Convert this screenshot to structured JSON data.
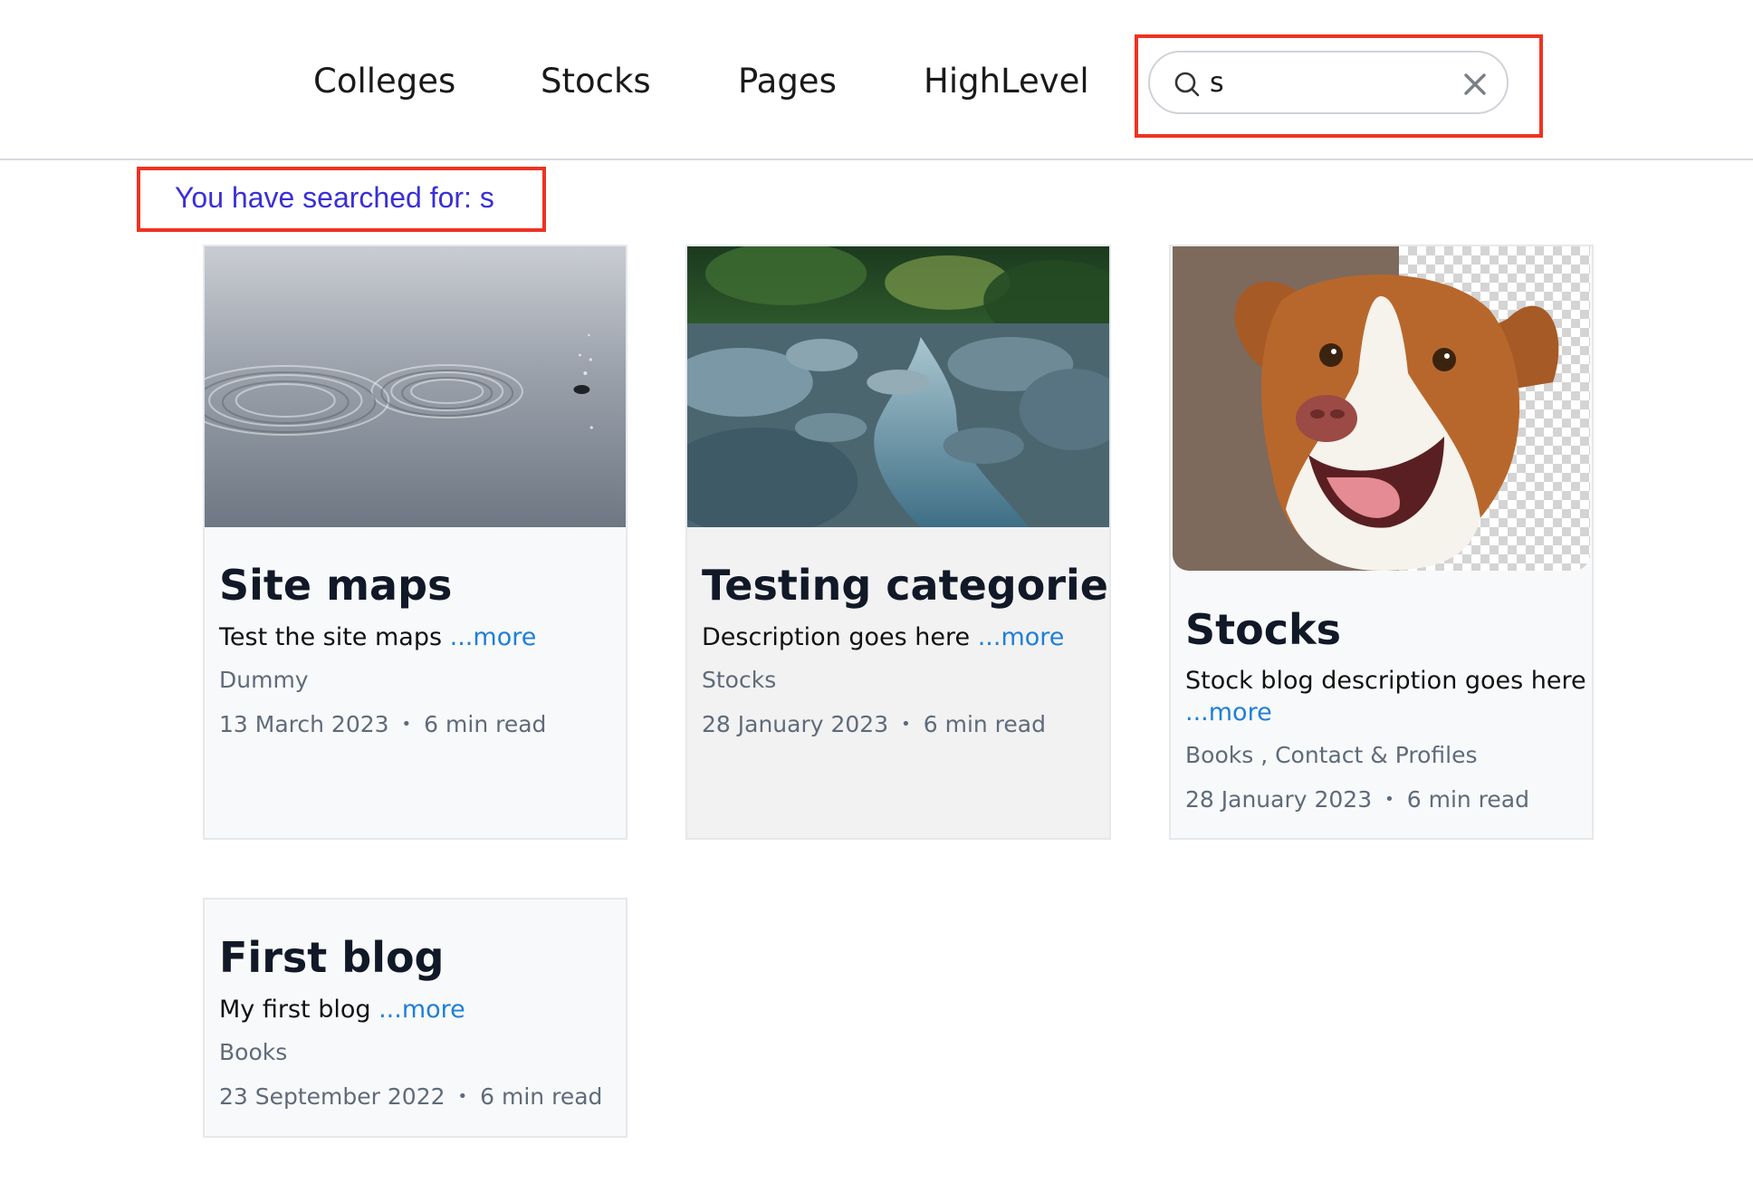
{
  "nav": {
    "items": [
      {
        "label": "Colleges"
      },
      {
        "label": "Stocks"
      },
      {
        "label": "Pages"
      },
      {
        "label": "HighLevel"
      }
    ]
  },
  "search": {
    "value": "s",
    "icon": "search-icon",
    "clear_icon": "close-icon"
  },
  "summary": {
    "text": "You have searched for: s"
  },
  "colors": {
    "highlight": "#ee3322",
    "summary_text": "#3a2fd6",
    "more_link": "#1e7fd8"
  },
  "cards": [
    {
      "title": "Site maps",
      "description": "Test the site maps",
      "more": "...more",
      "category": "Dummy",
      "date": "13 March 2023",
      "separator": "•",
      "read_time": "6 min read"
    },
    {
      "title": "Testing categories",
      "description": "Description goes here",
      "more": "...more",
      "category": "Stocks",
      "date": "28 January 2023",
      "separator": "•",
      "read_time": "6 min read"
    },
    {
      "title": "Stocks",
      "description": "Stock blog description goes here",
      "more": "...more",
      "category": "Books , Contact & Profiles",
      "date": "28 January 2023",
      "separator": "•",
      "read_time": "6 min read"
    },
    {
      "title": "First blog",
      "description": "My first blog",
      "more": "...more",
      "category": "Books",
      "date": "23 September 2022",
      "separator": "•",
      "read_time": "6 min read"
    }
  ]
}
